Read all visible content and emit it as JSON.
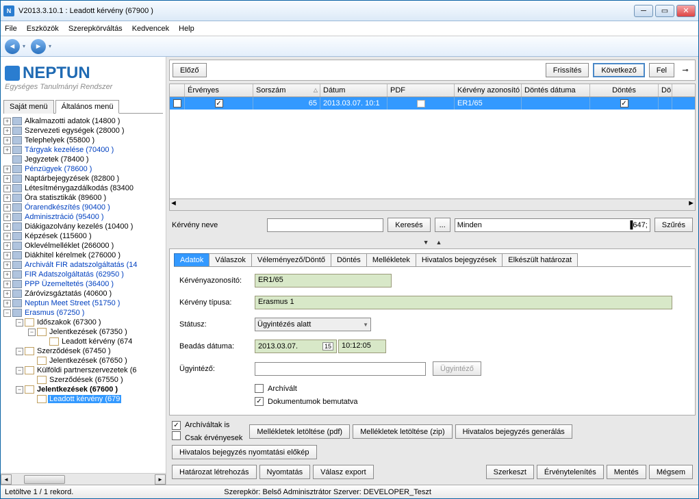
{
  "window": {
    "title": "V2013.3.10.1 : Leadott kérvény (67900  )"
  },
  "menu": {
    "file": "File",
    "eszkozok": "Eszközök",
    "szerepkor": "Szerepkörváltás",
    "kedvencek": "Kedvencek",
    "help": "Help"
  },
  "logo": {
    "main": "NEPTUN",
    "sub": "Egységes Tanulmányi Rendszer"
  },
  "sidetabs": {
    "t1": "Saját menü",
    "t2": "Általános menü"
  },
  "tree": [
    {
      "exp": "+",
      "label": "Alkalmazotti adatok (14800  )",
      "link": false,
      "ind": 0
    },
    {
      "exp": "+",
      "label": "Szervezeti egységek (28000  )",
      "link": false,
      "ind": 0
    },
    {
      "exp": "+",
      "label": "Telephelyek (55800  )",
      "link": false,
      "ind": 0
    },
    {
      "exp": "+",
      "label": "Tárgyak kezelése (70400  )",
      "link": true,
      "ind": 0
    },
    {
      "exp": " ",
      "label": "Jegyzetek (78400  )",
      "link": false,
      "ind": 0
    },
    {
      "exp": "+",
      "label": "Pénzügyek (78600  )",
      "link": true,
      "ind": 0
    },
    {
      "exp": "+",
      "label": "Naptárbejegyzések (82800  )",
      "link": false,
      "ind": 0
    },
    {
      "exp": "+",
      "label": "Létesítménygazdálkodás (83400",
      "link": false,
      "ind": 0
    },
    {
      "exp": "+",
      "label": "Óra statisztikák (89600  )",
      "link": false,
      "ind": 0
    },
    {
      "exp": "+",
      "label": "Órarendkészítés (90400  )",
      "link": true,
      "ind": 0
    },
    {
      "exp": "+",
      "label": "Adminisztráció (95400  )",
      "link": true,
      "ind": 0
    },
    {
      "exp": "+",
      "label": "Diákigazolvány kezelés (10400  )",
      "link": false,
      "ind": 0
    },
    {
      "exp": "+",
      "label": "Képzések (115600  )",
      "link": false,
      "ind": 0
    },
    {
      "exp": "+",
      "label": "Oklevélmelléklet (266000  )",
      "link": false,
      "ind": 0
    },
    {
      "exp": "+",
      "label": "Diákhitel kérelmek (276000  )",
      "link": false,
      "ind": 0
    },
    {
      "exp": "+",
      "label": "Archivált FIR adatszolgáltatás (14",
      "link": true,
      "ind": 0
    },
    {
      "exp": "+",
      "label": "FIR Adatszolgáltatás (62950  )",
      "link": true,
      "ind": 0
    },
    {
      "exp": "+",
      "label": "PPP Üzemeltetés (36400  )",
      "link": true,
      "ind": 0
    },
    {
      "exp": "+",
      "label": "Záróvizsgáztatás (40600  )",
      "link": false,
      "ind": 0
    },
    {
      "exp": "+",
      "label": "Neptun Meet Street (51750  )",
      "link": true,
      "ind": 0
    },
    {
      "exp": "−",
      "label": "Erasmus (67250  )",
      "link": true,
      "ind": 0
    },
    {
      "exp": "−",
      "label": "Időszakok (67300  )",
      "link": false,
      "ind": 1,
      "icon": "doc"
    },
    {
      "exp": "−",
      "label": "Jelentkezések (67350  )",
      "link": false,
      "ind": 2,
      "icon": "doc"
    },
    {
      "exp": " ",
      "label": "Leadott kérvény (674",
      "link": false,
      "ind": 3,
      "icon": "doc"
    },
    {
      "exp": "−",
      "label": "Szerződések (67450  )",
      "link": false,
      "ind": 1,
      "icon": "doc"
    },
    {
      "exp": " ",
      "label": "Jelentkezések (67650  )",
      "link": false,
      "ind": 2,
      "icon": "doc"
    },
    {
      "exp": "−",
      "label": "Külföldi partnerszervezetek (6",
      "link": false,
      "ind": 1,
      "icon": "doc"
    },
    {
      "exp": " ",
      "label": "Szerződések (67550  )",
      "link": false,
      "ind": 2,
      "icon": "doc"
    },
    {
      "exp": "−",
      "label": "Jelentkezések (67600  )",
      "link": false,
      "ind": 1,
      "icon": "doc",
      "bold": true
    },
    {
      "exp": " ",
      "label": "Leadott kérvény (679",
      "link": false,
      "ind": 2,
      "icon": "doc",
      "selected": true
    }
  ],
  "toolbar": {
    "prev": "Előző",
    "refresh": "Frissítés",
    "next": "Következő",
    "up": "Fel"
  },
  "grid": {
    "headers": {
      "ervenyes": "Érvényes",
      "sorszam": "Sorszám",
      "datum": "Dátum",
      "pdf": "PDF",
      "azon": "Kérvény azonosító",
      "dontes_datum": "Döntés dátuma",
      "dontes": "Döntés",
      "do": "Dö"
    },
    "row": {
      "sorszam": "65",
      "datum": "2013.03.07.  10:1",
      "azon": "ER1/65"
    }
  },
  "search": {
    "label": "Kérvény neve",
    "btn": "Keresés",
    "filter": "Minden",
    "szures": "Szűrés"
  },
  "dtabs": {
    "t1": "Adatok",
    "t2": "Válaszok",
    "t3": "Véleményező/Döntő",
    "t4": "Döntés",
    "t5": "Mellékletek",
    "t6": "Hivatalos bejegyzések",
    "t7": "Elkészült határozat"
  },
  "form": {
    "azon_label": "Kérvényazonosító:",
    "azon_val": "ER1/65",
    "tipus_label": "Kérvény típusa:",
    "tipus_val": "Erasmus 1",
    "status_label": "Státusz:",
    "status_val": "Ügyintézés alatt",
    "beadas_label": "Beadás dátuma:",
    "beadas_date": "2013.03.07.",
    "beadas_time": "10:12:05",
    "ugyintezo_label": "Ügyintéző:",
    "ugyintezo_btn": "Ügyintéző",
    "archivalt": "Archívált",
    "dokbemut": "Dokumentumok bemutatva"
  },
  "bottom": {
    "archivaltak_is": "Archíváltak is",
    "csak_erv": "Csak érvényesek",
    "pdf_dl": "Mellékletek letöltése (pdf)",
    "zip_dl": "Mellékletek letöltése (zip)",
    "hiv_gen": "Hivatalos bejegyzés generálás",
    "hiv_nyomt": "Hivatalos bejegyzés nyomtatási előkép",
    "hatarozat": "Határozat létrehozás",
    "nyomtatas": "Nyomtatás",
    "valasz_exp": "Válasz export",
    "szerkeszt": "Szerkeszt",
    "ervenytelenit": "Érvénytelenítés",
    "mentes": "Mentés",
    "megsem": "Mégsem"
  },
  "status": {
    "records": "Letöltve 1 / 1 rekord.",
    "role": "Szerepkör: Belső Adminisztrátor   Szerver: DEVELOPER_Teszt"
  }
}
